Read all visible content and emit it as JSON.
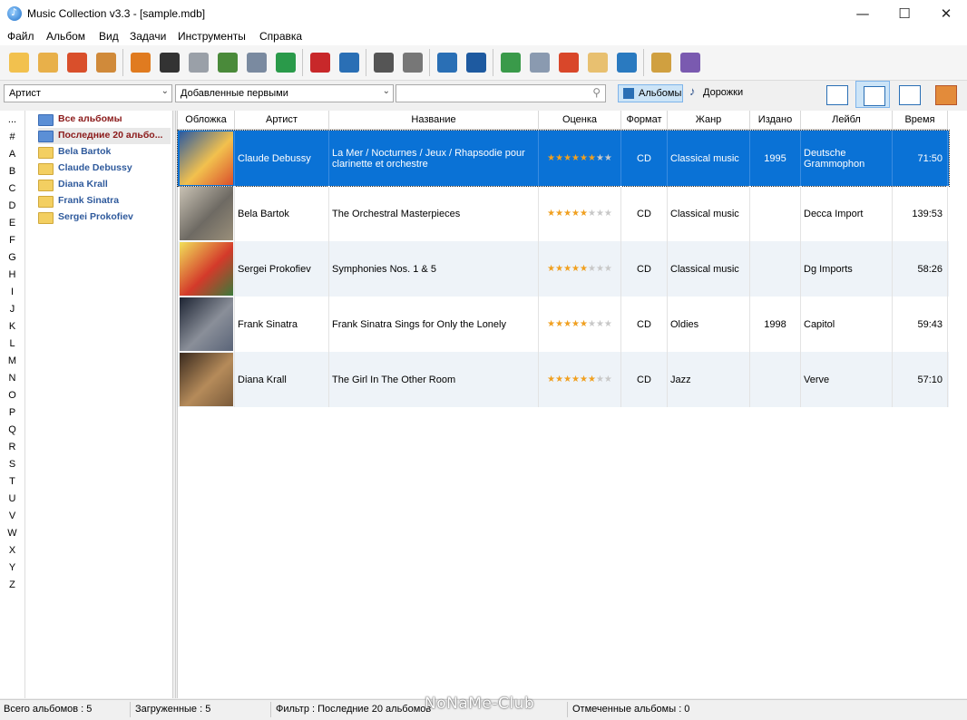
{
  "window": {
    "title": "Music Collection v3.3 - [sample.mdb]",
    "min_glyph": "—",
    "max_glyph": "☐",
    "close_glyph": "✕"
  },
  "menu": [
    "Файл",
    "Альбом",
    "Вид",
    "Задачи",
    "Инструменты",
    "Справка"
  ],
  "toolbar_icons": [
    "add-album-icon",
    "add-folder-icon",
    "add-disc-icon",
    "import-disc-icon",
    "eject-icon",
    "cd-text-icon",
    "download-icon",
    "find-icon",
    "scan-icon",
    "add-new-icon",
    "delete-icon",
    "edit-icon",
    "print-icon",
    "html-export-icon",
    "search-report-icon",
    "music-search-icon",
    "checklist-icon",
    "report-icon",
    "statistics-chart-icon",
    "archive-icon",
    "user-icon",
    "plugins-icon",
    "exit-icon"
  ],
  "filters": {
    "field": "Артист",
    "sort": "Добавленные первыми",
    "search_value": ""
  },
  "modes": {
    "albums": "Альбомы",
    "tracks": "Дорожки"
  },
  "views": [
    "details-view-icon",
    "list-view-icon",
    "grid-view-icon",
    "covers-view-icon"
  ],
  "letters": [
    "...",
    "#",
    "A",
    "B",
    "C",
    "D",
    "E",
    "F",
    "G",
    "H",
    "I",
    "J",
    "K",
    "L",
    "M",
    "N",
    "O",
    "P",
    "Q",
    "R",
    "S",
    "T",
    "U",
    "V",
    "W",
    "X",
    "Y",
    "Z"
  ],
  "tree": [
    {
      "label": "Все альбомы",
      "kind": "all"
    },
    {
      "label": "Последние 20 альбо...",
      "kind": "recent"
    },
    {
      "label": "Bela Bartok",
      "kind": "artist"
    },
    {
      "label": "Claude Debussy",
      "kind": "artist"
    },
    {
      "label": "Diana Krall",
      "kind": "artist"
    },
    {
      "label": "Frank Sinatra",
      "kind": "artist"
    },
    {
      "label": "Sergei Prokofiev",
      "kind": "artist"
    }
  ],
  "columns": [
    "Обложка",
    "Артист",
    "Название",
    "Оценка",
    "Формат",
    "Жанр",
    "Издано",
    "Лейбл",
    "Время"
  ],
  "albums": [
    {
      "artist": "Claude Debussy",
      "title": "La Mer / Nocturnes / Jeux / Rhapsodie pour clarinette et orchestre",
      "rating": 6,
      "format": "CD",
      "genre": "Classical music",
      "year": "1995",
      "label": "Deutsche Grammophon",
      "time": "71:50",
      "cover": [
        "#2c5aa0",
        "#f2c14e",
        "#d94f2b"
      ]
    },
    {
      "artist": "Bela Bartok",
      "title": "The Orchestral Masterpieces",
      "rating": 5,
      "format": "CD",
      "genre": "Classical music",
      "year": "",
      "label": "Decca Import",
      "time": "139:53",
      "cover": [
        "#c9c2b4",
        "#6e6a63",
        "#9a8f7a"
      ]
    },
    {
      "artist": "Sergei Prokofiev",
      "title": "Symphonies Nos. 1 & 5",
      "rating": 5,
      "format": "CD",
      "genre": "Classical music",
      "year": "",
      "label": "Dg Imports",
      "time": "58:26",
      "cover": [
        "#f1e05a",
        "#d43a2a",
        "#3a7a3a"
      ]
    },
    {
      "artist": "Frank Sinatra",
      "title": "Frank Sinatra Sings for Only the Lonely",
      "rating": 5,
      "format": "CD",
      "genre": "Oldies",
      "year": "1998",
      "label": "Capitol",
      "time": "59:43",
      "cover": [
        "#1d2433",
        "#8a8f99",
        "#5a6478"
      ]
    },
    {
      "artist": "Diana Krall",
      "title": "The Girl In The Other Room",
      "rating": 6,
      "format": "CD",
      "genre": "Jazz",
      "year": "",
      "label": "Verve",
      "time": "57:10",
      "cover": [
        "#3a2a1e",
        "#b58b5a",
        "#7a5a3a"
      ]
    }
  ],
  "status": {
    "total": "Всего альбомов : 5",
    "loaded": "Загруженные : 5",
    "filter": "Фильтр : Последние 20 альбомов",
    "marked": "Отмеченные альбомы : 0"
  },
  "watermark": "NoNaMe-Club",
  "colors": {
    "selection": "#0a72d6",
    "alt_row": "#eef3f8",
    "star": "#f0a020"
  }
}
